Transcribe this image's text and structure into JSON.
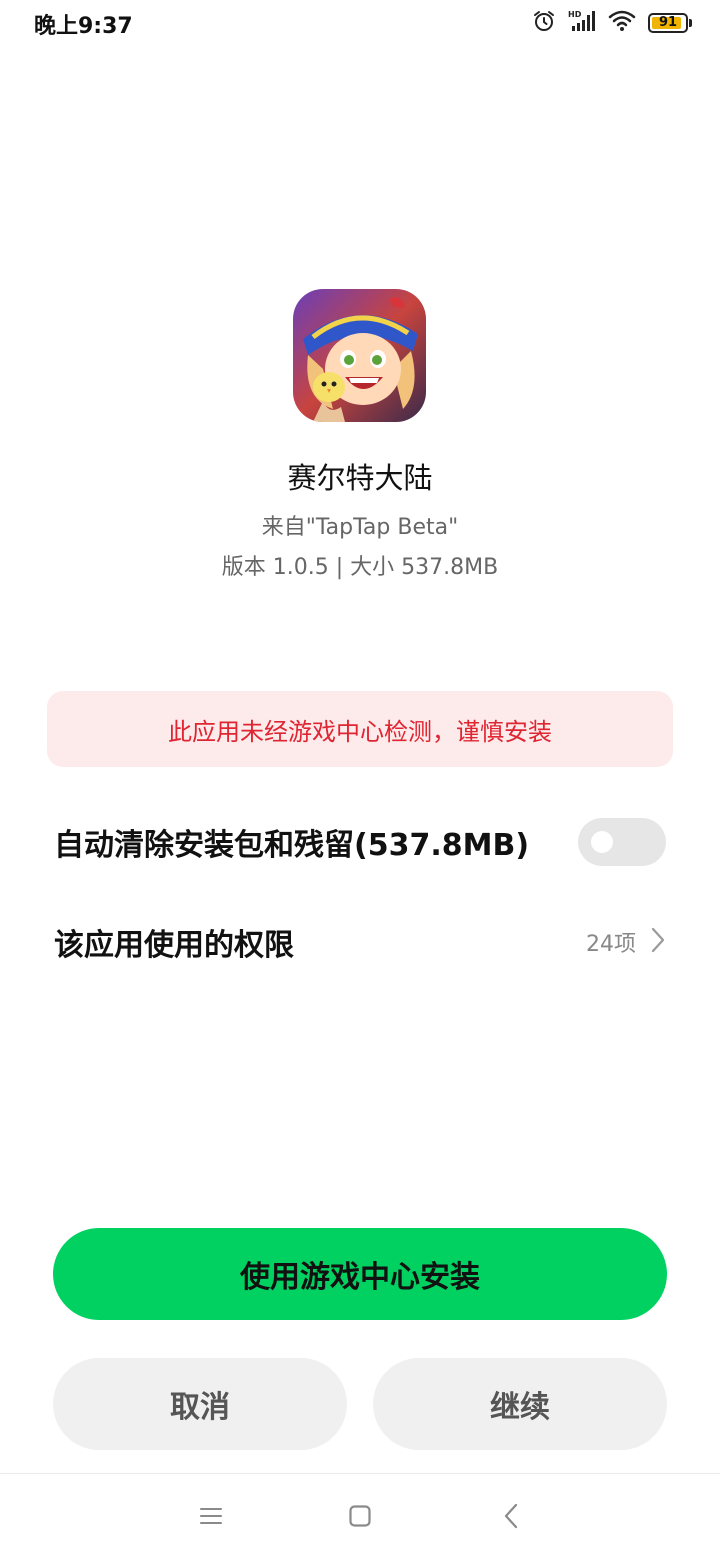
{
  "status_bar": {
    "time": "晚上9:37",
    "battery_level": "91",
    "battery_fraction": 0.91,
    "icons": [
      "alarm-icon",
      "hd-signal-icon",
      "wifi-icon",
      "battery-icon"
    ]
  },
  "app": {
    "icon": "game-character-icon",
    "name": "赛尔特大陆",
    "source": "来自\"TapTap Beta\"",
    "meta": "版本 1.0.5 | 大小 537.8MB"
  },
  "warning": {
    "text": "此应用未经游戏中心检测，谨慎安装",
    "color": "#e02532",
    "background": "#fdebec"
  },
  "settings": {
    "auto_clean_label": "自动清除安装包和残留(537.8MB)",
    "auto_clean_enabled": false,
    "permissions_label": "该应用使用的权限",
    "permissions_count": "24项"
  },
  "actions": {
    "primary_label": "使用游戏中心安装",
    "primary_color": "#00d161",
    "cancel_label": "取消",
    "continue_label": "继续"
  },
  "nav_bar": {
    "icons": [
      "menu-icon",
      "home-icon",
      "back-icon"
    ]
  }
}
